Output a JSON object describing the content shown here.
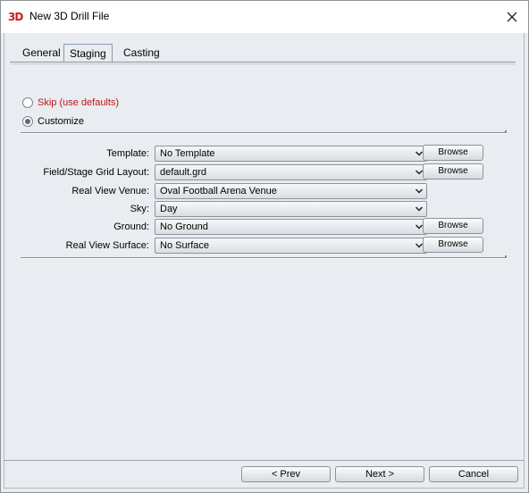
{
  "window": {
    "icon_text": "3D",
    "title": "New 3D Drill File"
  },
  "tabs": [
    {
      "label": "General"
    },
    {
      "label": "Staging"
    },
    {
      "label": "Casting"
    }
  ],
  "options": {
    "skip_label": "Skip (use defaults)",
    "customize_label": "Customize",
    "selected": "Customize"
  },
  "fields": [
    {
      "label": "Template:",
      "value": "No Template",
      "browse": "Browse"
    },
    {
      "label": "Field/Stage Grid Layout:",
      "value": "default.grd",
      "browse": "Browse"
    },
    {
      "label": "Real View Venue:",
      "value": "Oval Football Arena Venue"
    },
    {
      "label": "Sky:",
      "value": "Day"
    },
    {
      "label": "Ground:",
      "value": "No Ground",
      "browse": "Browse"
    },
    {
      "label": "Real View Surface:",
      "value": "No Surface",
      "browse": "Browse"
    }
  ],
  "footer": {
    "prev": "< Prev",
    "next": "Next >",
    "cancel": "Cancel"
  },
  "colors": {
    "skip_text": "#c0141b",
    "icon": "#cc1f1a",
    "dialog_bg": "#e9ecf0"
  }
}
